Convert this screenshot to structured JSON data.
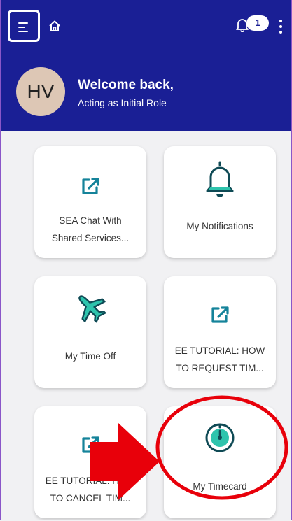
{
  "header": {
    "notification_count": "1",
    "avatar_initials": "HV",
    "welcome_text": "Welcome back,",
    "role_text": "Acting as Initial Role"
  },
  "tiles": [
    {
      "label_line1": "SEA Chat With",
      "label_line2": "Shared Services...",
      "icon": "external-link-icon"
    },
    {
      "label_line1": "My Notifications",
      "icon": "bell-icon"
    },
    {
      "label_line1": "My Time Off",
      "icon": "airplane-icon"
    },
    {
      "label_line1": "EE TUTORIAL: HOW",
      "label_line2": "TO REQUEST TIM...",
      "icon": "external-link-icon"
    },
    {
      "label_line1": "EE TUTORIAL: HOW",
      "label_line2": "TO CANCEL TIM...",
      "icon": "external-link-icon"
    },
    {
      "label_line1": "My Timecard",
      "icon": "clock-icon"
    }
  ],
  "colors": {
    "header_bg": "#1a1f95",
    "accent_teal": "#15839a",
    "annotation_red": "#e8000a"
  }
}
